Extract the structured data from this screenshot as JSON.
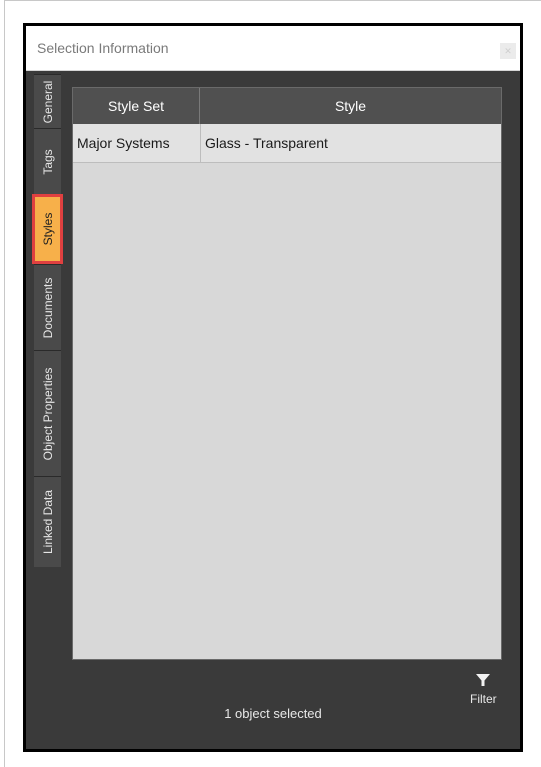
{
  "window": {
    "title": "Selection Information",
    "close_icon": "close-icon"
  },
  "tabs": [
    {
      "label": "General",
      "active": false
    },
    {
      "label": "Tags",
      "active": false
    },
    {
      "label": "Styles",
      "active": true
    },
    {
      "label": "Documents",
      "active": false
    },
    {
      "label": "Object Properties",
      "active": false
    },
    {
      "label": "Linked Data",
      "active": false
    }
  ],
  "table": {
    "headers": [
      "Style Set",
      "Style"
    ],
    "rows": [
      [
        "Major Systems",
        "Glass - Transparent"
      ]
    ]
  },
  "status": {
    "text": "1 object selected"
  },
  "filter": {
    "label": "Filter",
    "icon": "filter-icon"
  },
  "colors": {
    "active_tab_bg": "#f7b04a",
    "active_tab_border": "#e04040",
    "panel_bg": "#3a3a3a"
  }
}
